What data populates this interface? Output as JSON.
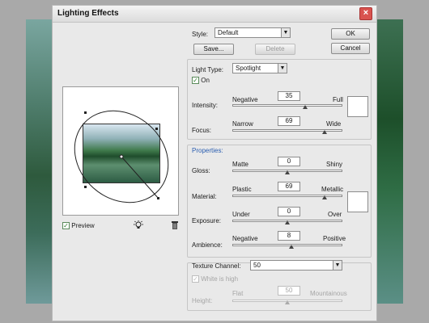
{
  "window": {
    "title": "Lighting Effects",
    "close_icon": "×"
  },
  "style": {
    "label": "Style:",
    "value": "Default",
    "save_label": "Save...",
    "delete_label": "Delete"
  },
  "buttons": {
    "ok": "OK",
    "cancel": "Cancel"
  },
  "light_type": {
    "label": "Light Type:",
    "value": "Spotlight",
    "on_label": "On",
    "on_checked": true
  },
  "intensity": {
    "label": "Intensity:",
    "min_label": "Negative",
    "max_label": "Full",
    "value": "35"
  },
  "focus": {
    "label": "Focus:",
    "min_label": "Narrow",
    "max_label": "Wide",
    "value": "69"
  },
  "properties": {
    "heading": "Properties:",
    "gloss": {
      "label": "Gloss:",
      "min_label": "Matte",
      "max_label": "Shiny",
      "value": "0"
    },
    "material": {
      "label": "Material:",
      "min_label": "Plastic",
      "max_label": "Metallic",
      "value": "69"
    },
    "exposure": {
      "label": "Exposure:",
      "min_label": "Under",
      "max_label": "Over",
      "value": "0"
    },
    "ambience": {
      "label": "Ambience:",
      "min_label": "Negative",
      "max_label": "Positive",
      "value": "8"
    }
  },
  "texture": {
    "label": "Texture Channel:",
    "value": "50",
    "white_is_high_label": "White is high",
    "height_label": "Height:",
    "min_label": "Flat",
    "max_label": "Mountainous"
  },
  "preview": {
    "label": "Preview",
    "checked": true
  },
  "icons": {
    "light_bulb": "light-bulb-icon",
    "trash": "trash-icon"
  },
  "colors": {
    "accent": "#2a5db0",
    "close": "#d9534f"
  }
}
